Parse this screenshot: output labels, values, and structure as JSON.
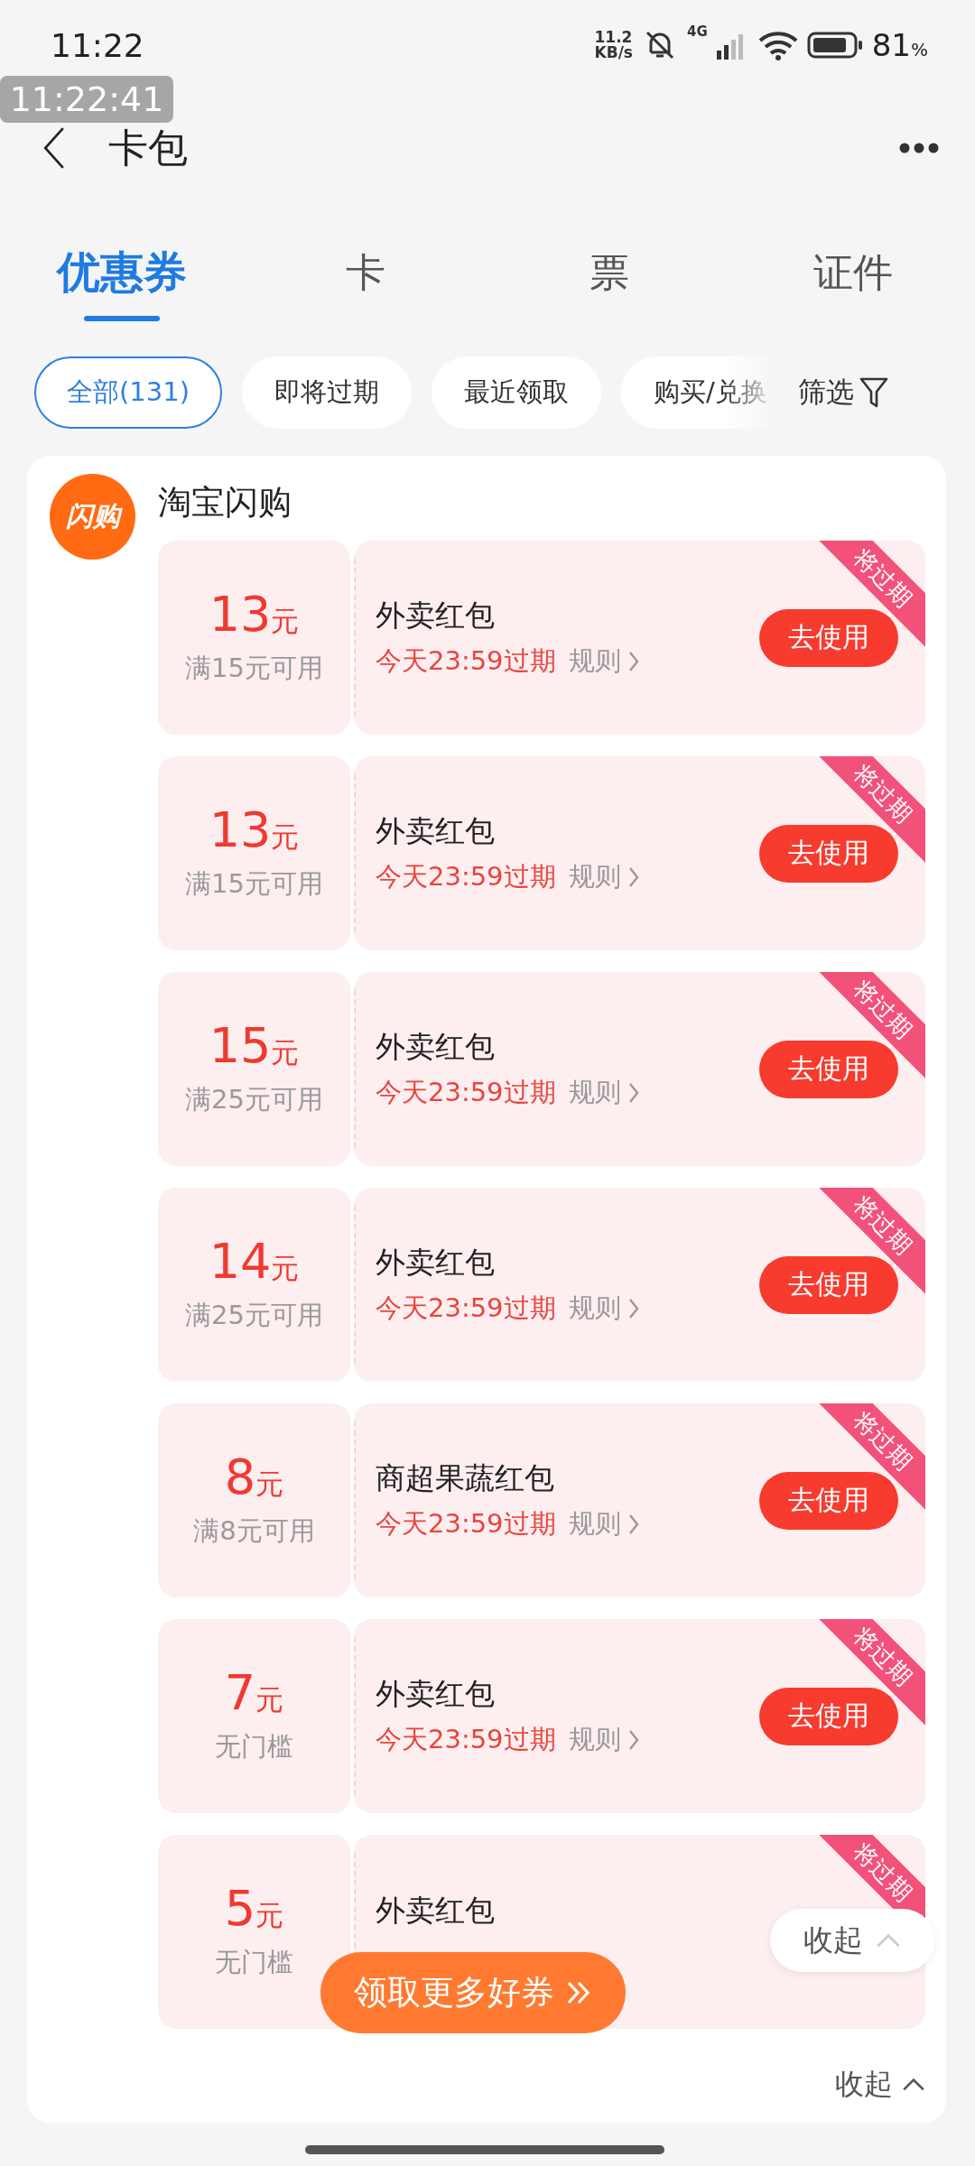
{
  "status_bar": {
    "time": "11:22",
    "net_speed": "11.2",
    "net_unit": "KB/s",
    "network": "4G",
    "battery": "81",
    "battery_unit": "%"
  },
  "recording_timestamp": "11:22:41",
  "header": {
    "title": "卡包"
  },
  "tabs": [
    {
      "label": "优惠券",
      "selected": true
    },
    {
      "label": "卡",
      "selected": false
    },
    {
      "label": "票",
      "selected": false
    },
    {
      "label": "证件",
      "selected": false
    }
  ],
  "filters": [
    {
      "label": "全部(131)",
      "selected": true
    },
    {
      "label": "即将过期",
      "selected": false
    },
    {
      "label": "最近领取",
      "selected": false
    },
    {
      "label": "购买/兑换",
      "selected": false
    }
  ],
  "filter_button": "筛选",
  "merchant": {
    "name": "淘宝闪购",
    "logo_text": "闪购"
  },
  "coupons": [
    {
      "amount": "13",
      "unit": "元",
      "condition": "满15元可用",
      "title": "外卖红包",
      "expiry": "今天23:59过期",
      "rules": "规则",
      "action": "去使用",
      "badge": "将过期"
    },
    {
      "amount": "13",
      "unit": "元",
      "condition": "满15元可用",
      "title": "外卖红包",
      "expiry": "今天23:59过期",
      "rules": "规则",
      "action": "去使用",
      "badge": "将过期"
    },
    {
      "amount": "15",
      "unit": "元",
      "condition": "满25元可用",
      "title": "外卖红包",
      "expiry": "今天23:59过期",
      "rules": "规则",
      "action": "去使用",
      "badge": "将过期"
    },
    {
      "amount": "14",
      "unit": "元",
      "condition": "满25元可用",
      "title": "外卖红包",
      "expiry": "今天23:59过期",
      "rules": "规则",
      "action": "去使用",
      "badge": "将过期"
    },
    {
      "amount": "8",
      "unit": "元",
      "condition": "满8元可用",
      "title": "商超果蔬红包",
      "expiry": "今天23:59过期",
      "rules": "规则",
      "action": "去使用",
      "badge": "将过期"
    },
    {
      "amount": "7",
      "unit": "元",
      "condition": "无门槛",
      "title": "外卖红包",
      "expiry": "今天23:59过期",
      "rules": "规则",
      "action": "去使用",
      "badge": "将过期"
    },
    {
      "amount": "5",
      "unit": "元",
      "condition": "无门槛",
      "title": "外卖红包",
      "badge": "将过期"
    }
  ],
  "collapse": "收起",
  "float_more_button": "领取更多好券",
  "float_collapse": "收起"
}
